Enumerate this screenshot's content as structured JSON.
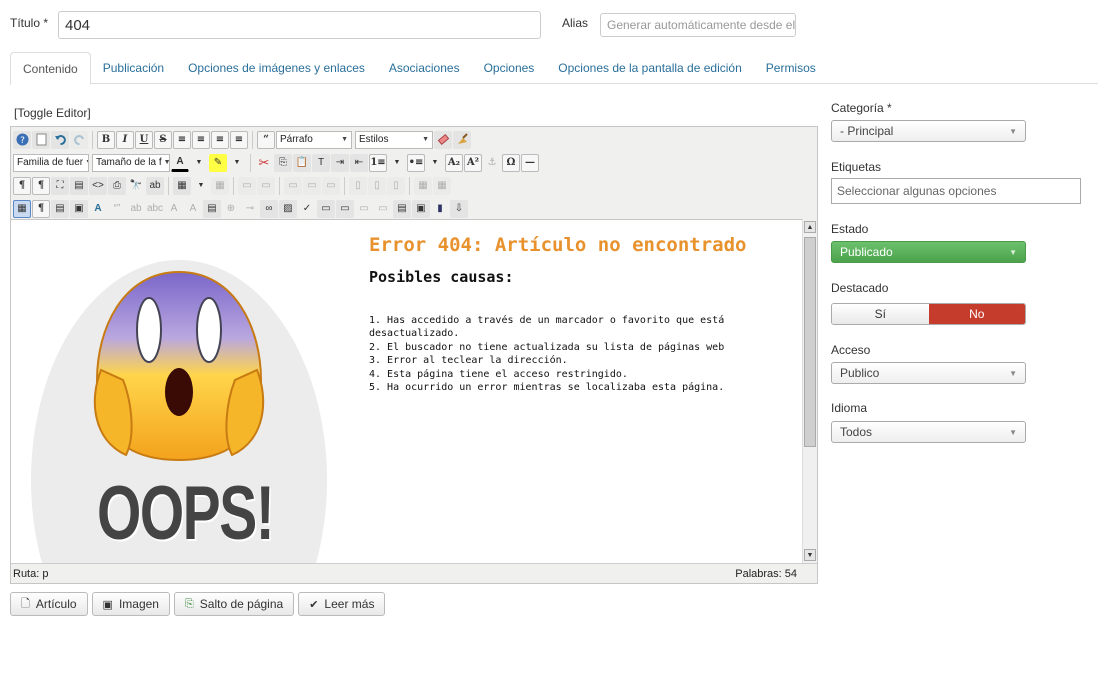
{
  "header": {
    "title_label": "Título *",
    "title_value": "404",
    "alias_label": "Alias",
    "alias_placeholder": "Generar automáticamente desde el"
  },
  "tabs": [
    {
      "label": "Contenido",
      "active": true
    },
    {
      "label": "Publicación"
    },
    {
      "label": "Opciones de imágenes y enlaces"
    },
    {
      "label": "Asociaciones"
    },
    {
      "label": "Opciones"
    },
    {
      "label": "Opciones de la pantalla de edición"
    },
    {
      "label": "Permisos"
    }
  ],
  "editor": {
    "toggle_label": "[Toggle Editor]",
    "format_select": "Párrafo",
    "styles_select": "Estilos",
    "font_family_select": "Familia de fuer",
    "font_size_select": "Tamaño de la f",
    "content": {
      "image_text": "OOPS!",
      "title": "Error 404: Artículo no encontrado",
      "subtitle": "Posibles causas:",
      "causes": [
        "1. Has accedido a través de un marcador o favorito que está desactualizado.",
        "2. El buscador no tiene actualizada su lista de páginas web",
        "3. Error al teclear la dirección.",
        "4. Esta página tiene el acceso restringido.",
        "5. Ha ocurrido un error mientras se localizaba esta página."
      ]
    },
    "status_path": "Ruta:  p",
    "status_words": "Palabras: 54"
  },
  "buttons": {
    "article": "Artículo",
    "image": "Imagen",
    "page_break": "Salto de página",
    "read_more": "Leer más"
  },
  "sidebar": {
    "category_label": "Categoría *",
    "category_value": "- Principal",
    "tags_label": "Etiquetas",
    "tags_placeholder": "Seleccionar algunas opciones",
    "status_label": "Estado",
    "status_value": "Publicado",
    "featured_label": "Destacado",
    "featured_yes": "Sí",
    "featured_no": "No",
    "featured_value": "No",
    "access_label": "Acceso",
    "access_value": "Publico",
    "language_label": "Idioma",
    "language_value": "Todos"
  },
  "colors": {
    "accent_link": "#2a6f9a",
    "error_title": "#e8922e",
    "published_green": "#5cb25c",
    "no_red": "#c53b2c"
  }
}
